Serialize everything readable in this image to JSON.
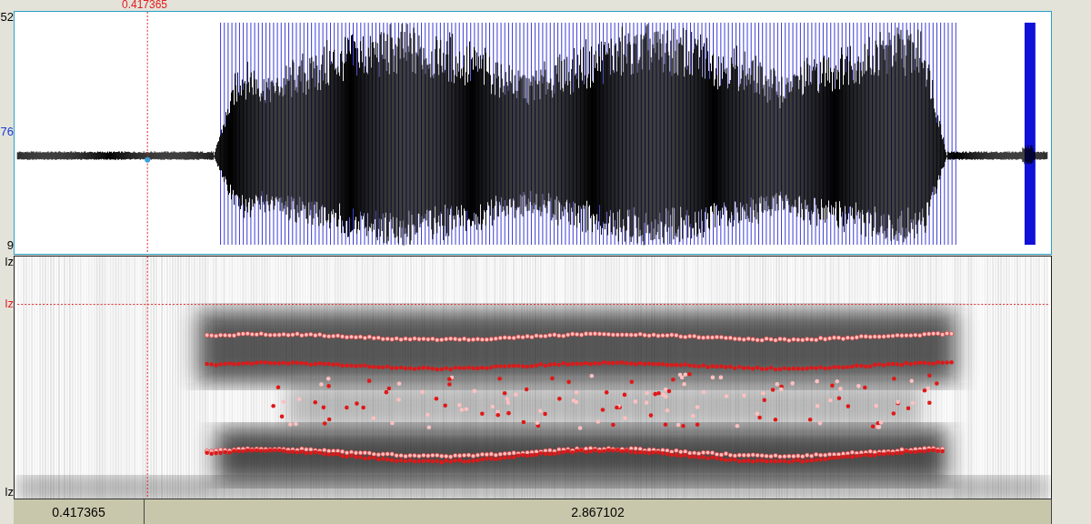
{
  "cursor": {
    "time": "0.417365"
  },
  "waveform": {
    "axis_labels": [
      "52",
      "76",
      "9"
    ]
  },
  "spectrogram": {
    "axis_top": "lz",
    "cursor_label": "lz",
    "axis_bottom": "lz"
  },
  "time_bar": [
    "0.417365",
    "2.867102"
  ]
}
